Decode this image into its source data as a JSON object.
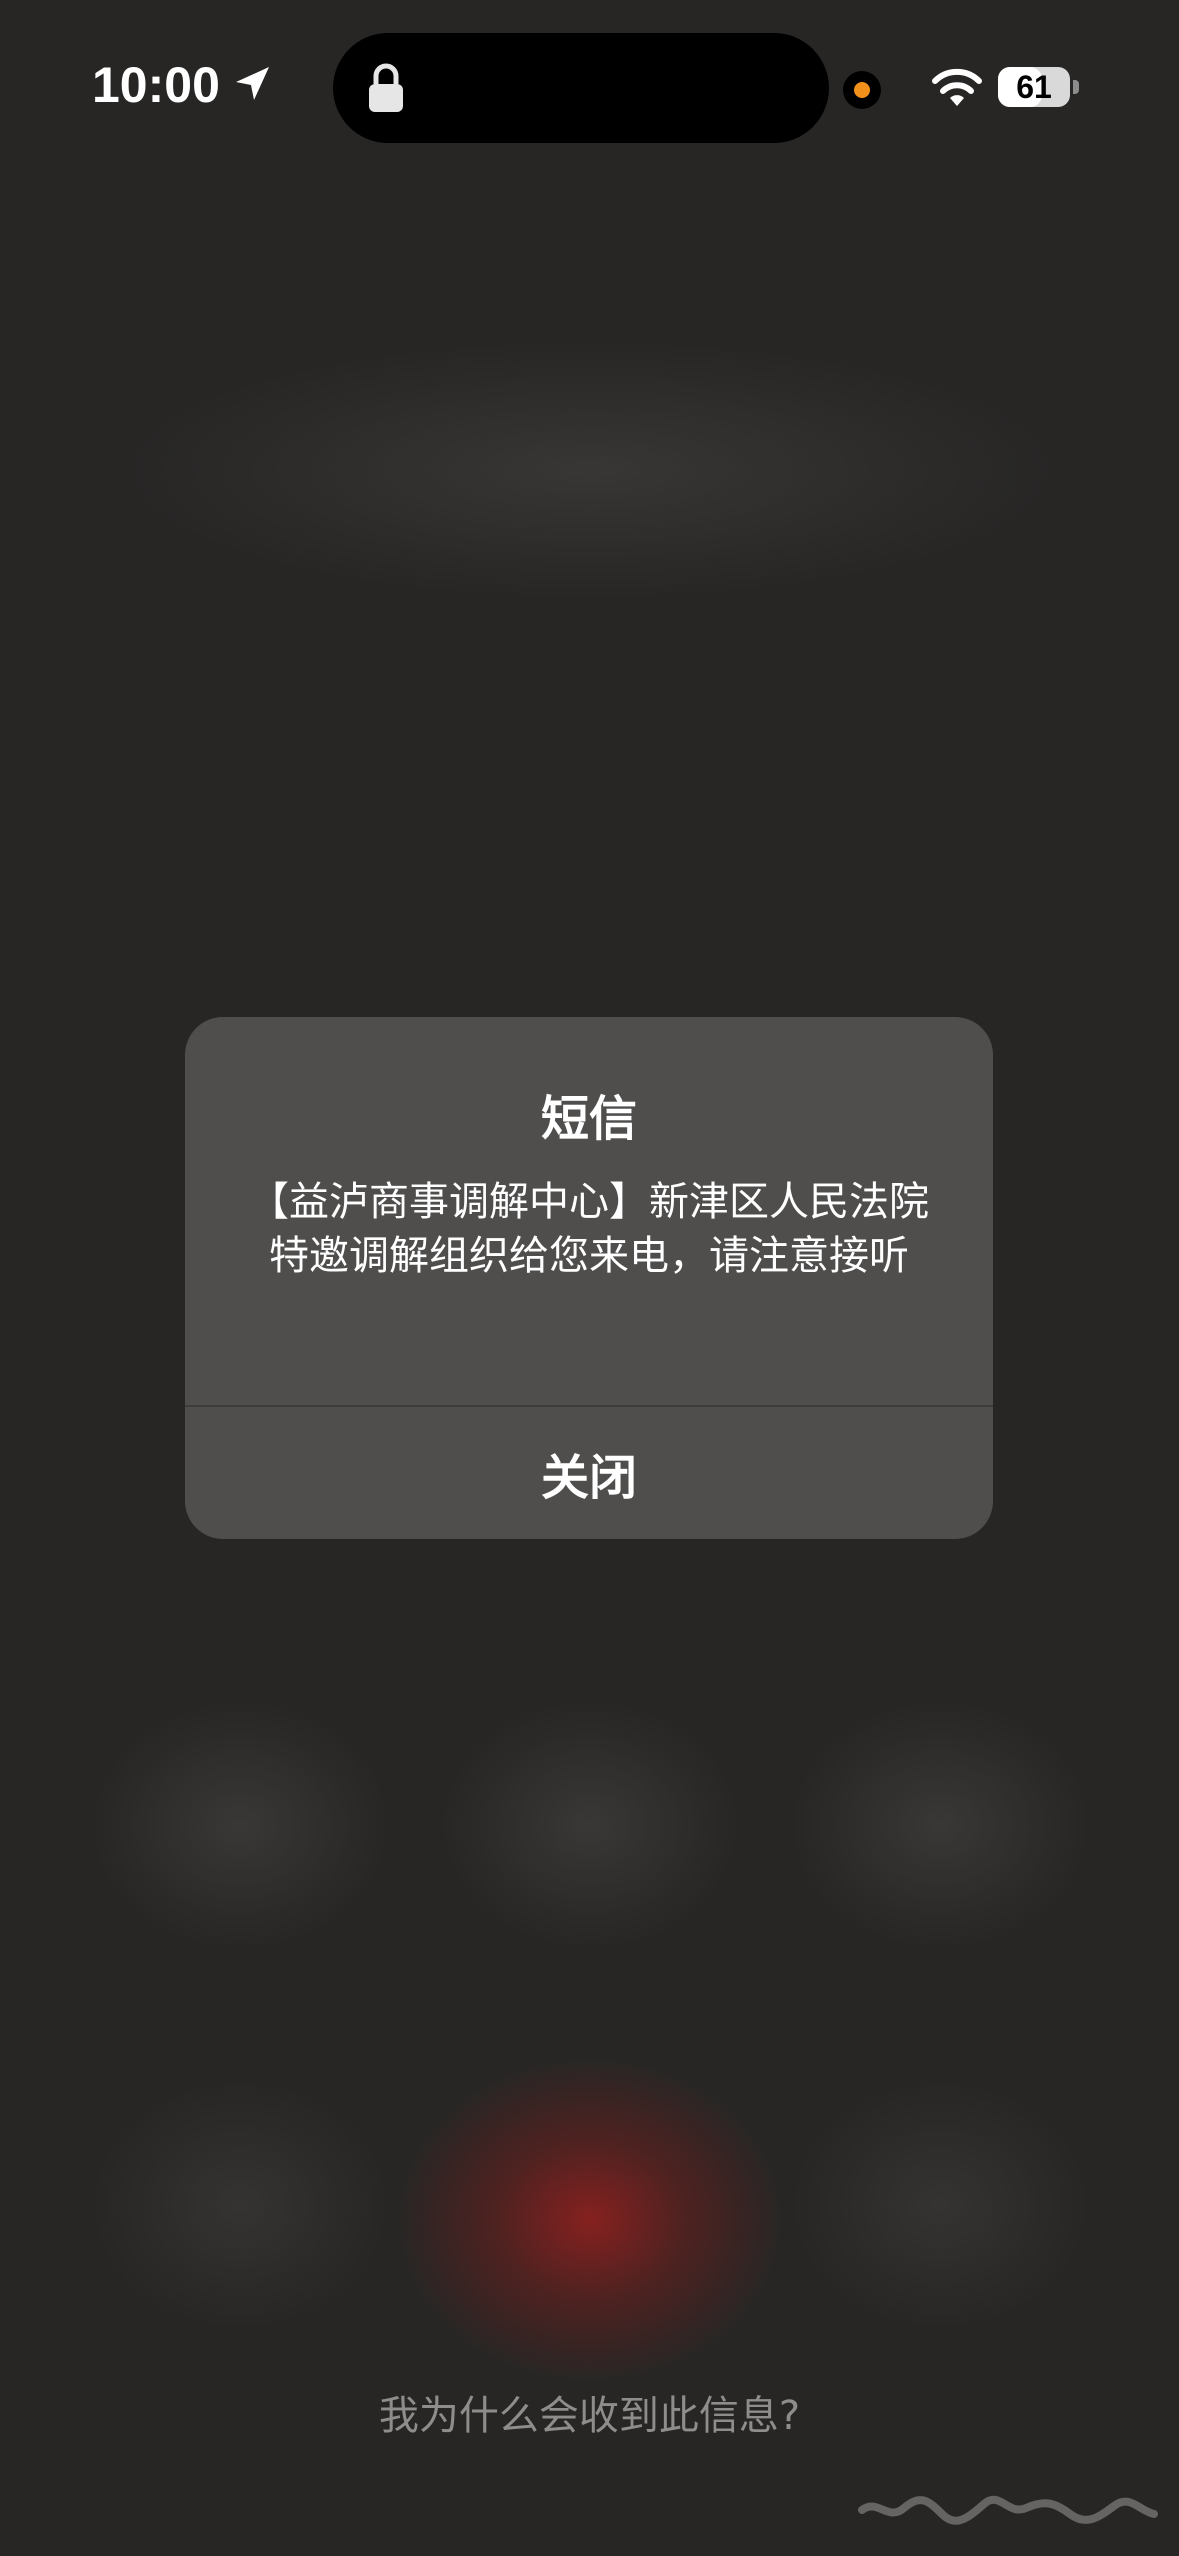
{
  "status_bar": {
    "time": "10:00",
    "battery_level": "61",
    "battery_percent": 61,
    "accent_recording": "#f2901c"
  },
  "alert": {
    "title": "短信",
    "message": "【益泸商事调解中心】新津区人民法院特邀调解组织给您来电，请注意接听",
    "close_label": "关闭"
  },
  "footer": {
    "why_link": "我为什么会收到此信息?"
  },
  "icons": [
    "location-arrow-icon",
    "lock-icon",
    "wifi-icon",
    "battery-icon"
  ]
}
